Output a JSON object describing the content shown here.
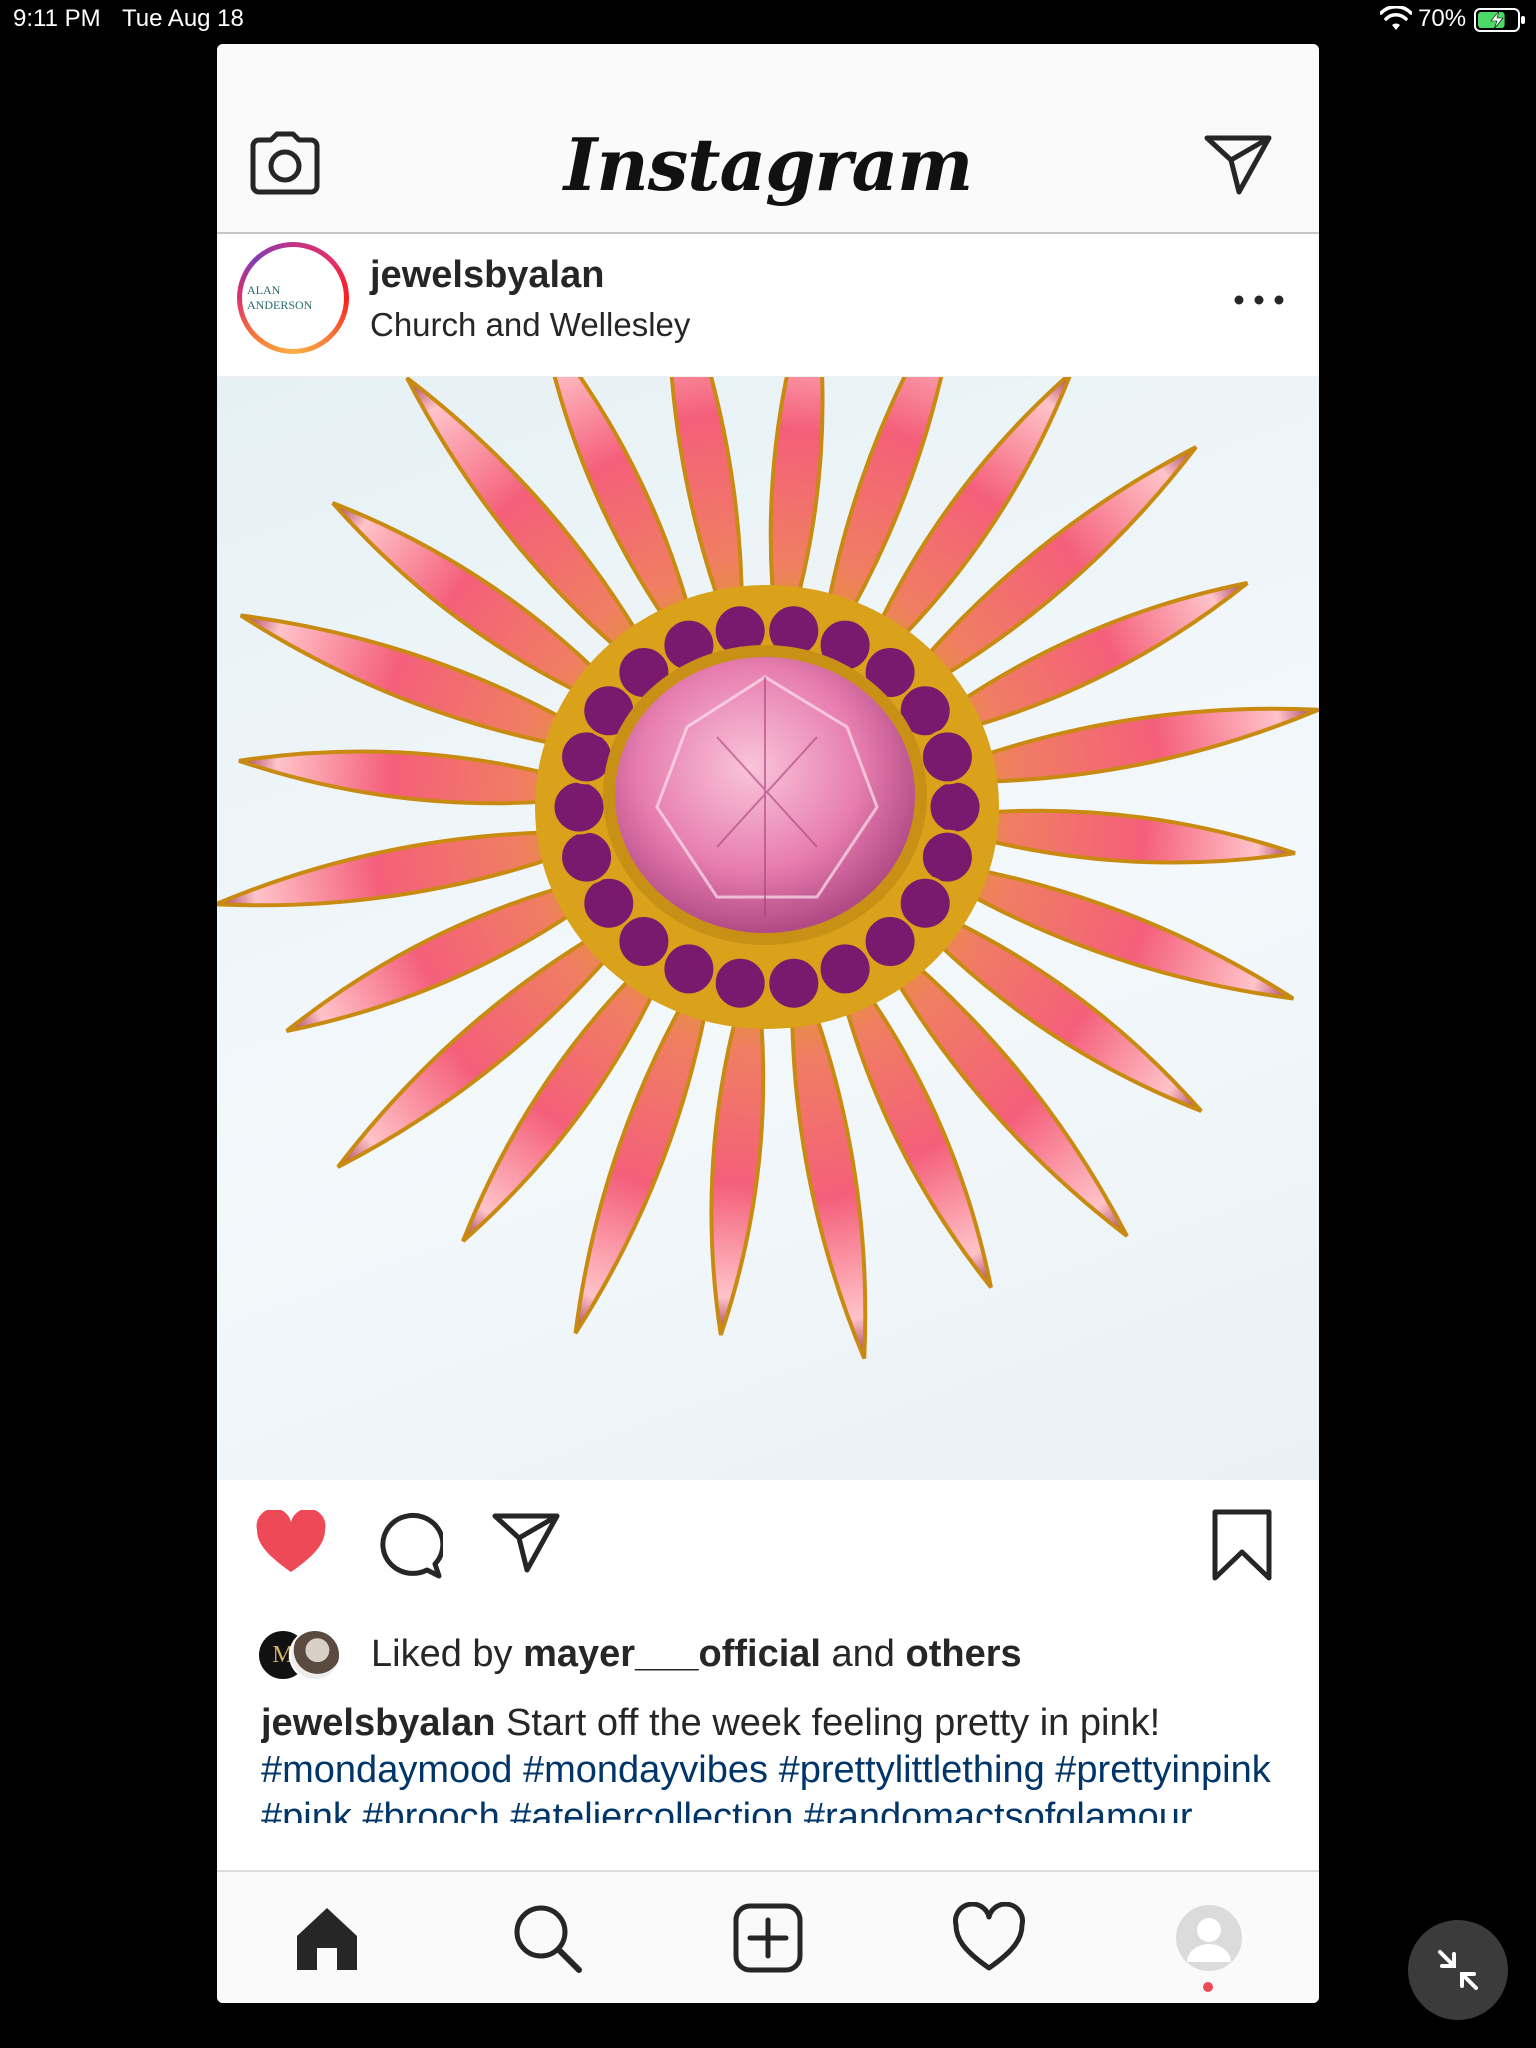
{
  "status_bar": {
    "time": "9:11 PM",
    "date": "Tue Aug 18",
    "battery_percent": "70%",
    "battery_level": 0.7,
    "charging": true,
    "wifi_icon": "wifi-icon"
  },
  "header": {
    "logo_text": "Instagram",
    "camera_icon": "camera-icon",
    "direct_icon": "paper-plane-icon"
  },
  "post": {
    "username": "jewelsbyalan",
    "location": "Church and Wellesley",
    "avatar_text": "ALAN ANDERSON",
    "more_icon": "more-horizontal-icon",
    "image_alt": "pink and orange crystal flower brooch"
  },
  "actions": {
    "liked": true,
    "like_icon": "heart-filled-icon",
    "comment_icon": "comment-icon",
    "share_icon": "paper-plane-icon",
    "save_icon": "bookmark-icon"
  },
  "likes": {
    "prefix": "Liked by",
    "user": "mayer___official",
    "joiner": "and",
    "others": "others",
    "avatar1_text": "M"
  },
  "caption": {
    "user": "jewelsbyalan",
    "text": "Start off the week feeling pretty in pink!",
    "hashtags": [
      "#mondaymood",
      "#mondayvibes",
      "#prettylittlething",
      "#prettyinpink",
      "#pink",
      "#brooch",
      "#ateliercollection",
      "#randomactsofglamour"
    ]
  },
  "tabbar": {
    "items": [
      {
        "name": "home",
        "icon": "home-icon"
      },
      {
        "name": "search",
        "icon": "search-icon"
      },
      {
        "name": "new-post",
        "icon": "plus-square-icon"
      },
      {
        "name": "activity",
        "icon": "heart-icon"
      },
      {
        "name": "profile",
        "icon": "profile-avatar-icon"
      }
    ]
  },
  "colors": {
    "like_red": "#ed4956",
    "hashtag_blue": "#003569",
    "text": "#262626",
    "battery_green": "#4cd964"
  }
}
